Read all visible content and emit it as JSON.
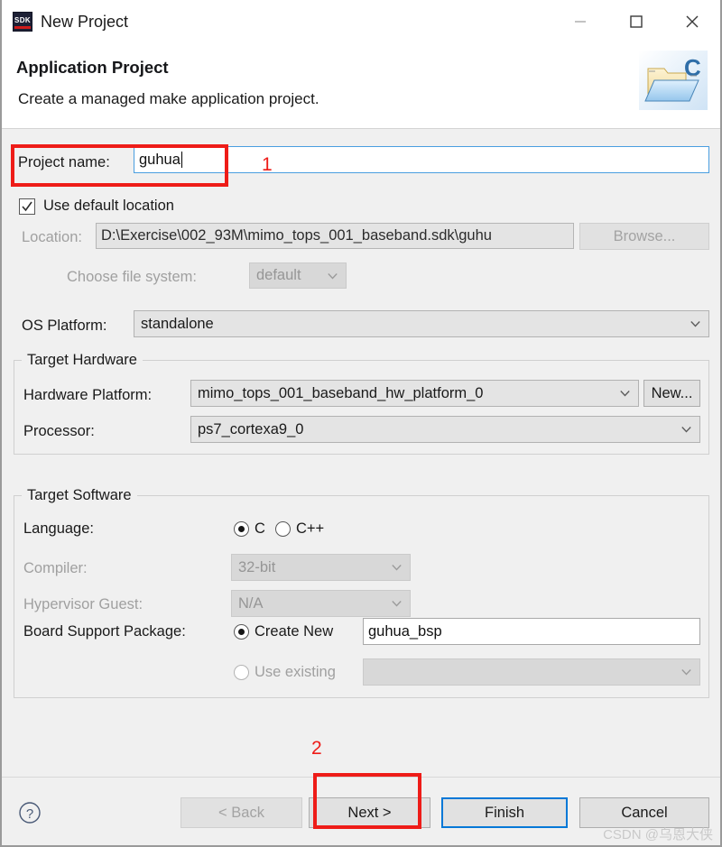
{
  "window": {
    "title": "New Project",
    "icon": "sdk-icon",
    "minimize_label": "Minimize",
    "maximize_label": "Maximize",
    "close_label": "Close"
  },
  "header": {
    "title": "Application Project",
    "description": "Create a managed make application project.",
    "icon": "folder-c-icon"
  },
  "form": {
    "project_name_label": "Project name:",
    "project_name_value": "guhua",
    "use_default_location_label": "Use default location",
    "use_default_location_checked": true,
    "location_label": "Location:",
    "location_value": "D:\\Exercise\\002_93M\\mimo_tops_001_baseband.sdk\\guhu",
    "browse_label": "Browse...",
    "choose_file_system_label": "Choose file system:",
    "choose_file_system_value": "default",
    "os_platform_label": "OS Platform:",
    "os_platform_value": "standalone"
  },
  "target_hardware": {
    "group_title": "Target Hardware",
    "hardware_platform_label": "Hardware Platform:",
    "hardware_platform_value": "mimo_tops_001_baseband_hw_platform_0",
    "new_label": "New...",
    "processor_label": "Processor:",
    "processor_value": "ps7_cortexa9_0"
  },
  "target_software": {
    "group_title": "Target Software",
    "language_label": "Language:",
    "language_option_c": "C",
    "language_option_cpp": "C++",
    "language_selected": "C",
    "compiler_label": "Compiler:",
    "compiler_value": "32-bit",
    "hypervisor_guest_label": "Hypervisor Guest:",
    "hypervisor_guest_value": "N/A",
    "bsp_label": "Board Support Package:",
    "bsp_create_new_label": "Create New",
    "bsp_create_new_value": "guhua_bsp",
    "bsp_use_existing_label": "Use existing",
    "bsp_use_existing_value": "",
    "bsp_selected": "Create New"
  },
  "footer": {
    "help_label": "?",
    "back_label": "< Back",
    "next_label": "Next >",
    "finish_label": "Finish",
    "cancel_label": "Cancel"
  },
  "annotations": {
    "step_one": "1",
    "step_two": "2"
  },
  "watermark": "CSDN @乌恩大侠",
  "colors": {
    "annotation_red": "#ee1c18",
    "default_button_blue": "#0078d7",
    "focus_blue": "#4a9ee0"
  }
}
